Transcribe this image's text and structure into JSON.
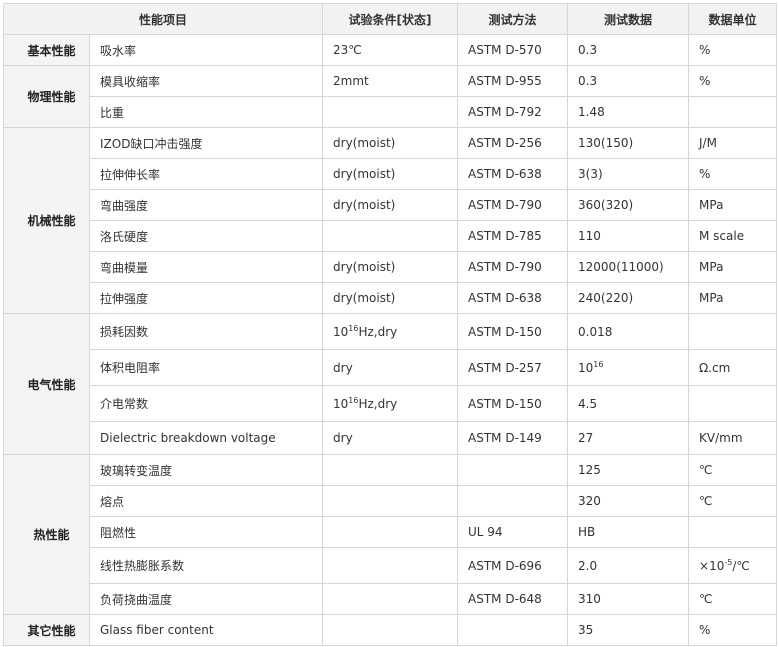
{
  "headers": [
    "性能项目",
    "试验条件[状态]",
    "测试方法",
    "测试数据",
    "数据单位"
  ],
  "groups": [
    {
      "category": "基本性能",
      "rows": [
        {
          "item": "吸水率",
          "condition": "23℃",
          "method": "ASTM D-570",
          "value": "0.3",
          "unit": "%"
        }
      ]
    },
    {
      "category": "物理性能",
      "rows": [
        {
          "item": "模具收缩率",
          "condition": "2mmt",
          "method": "ASTM D-955",
          "value": "0.3",
          "unit": "%"
        },
        {
          "item": "比重",
          "condition": "",
          "method": "ASTM D-792",
          "value": "1.48",
          "unit": ""
        }
      ]
    },
    {
      "category": "机械性能",
      "rows": [
        {
          "item": "IZOD缺口冲击强度",
          "condition": "dry(moist)",
          "method": "ASTM D-256",
          "value": "130(150)",
          "unit": "J/M"
        },
        {
          "item": "拉伸伸长率",
          "condition": "dry(moist)",
          "method": "ASTM D-638",
          "value": "3(3)",
          "unit": "%"
        },
        {
          "item": "弯曲强度",
          "condition": "dry(moist)",
          "method": "ASTM D-790",
          "value": "360(320)",
          "unit": "MPa"
        },
        {
          "item": "洛氏硬度",
          "condition": "",
          "method": "ASTM D-785",
          "value": "110",
          "unit": "M scale"
        },
        {
          "item": "弯曲模量",
          "condition": "dry(moist)",
          "method": "ASTM D-790",
          "value": "12000(11000)",
          "unit": "MPa"
        },
        {
          "item": "拉伸强度",
          "condition": "dry(moist)",
          "method": "ASTM D-638",
          "value": "240(220)",
          "unit": "MPa"
        }
      ]
    },
    {
      "category": "电气性能",
      "rows": [
        {
          "item": "损耗因数",
          "condition_base": "10",
          "condition_exp": "16",
          "condition_rest": "Hz,dry",
          "method": "ASTM D-150",
          "value": "0.018",
          "unit": ""
        },
        {
          "item": "体积电阻率",
          "condition": "dry",
          "method": "ASTM D-257",
          "value_base": "10",
          "value_exp": "16",
          "unit": "Ω.cm"
        },
        {
          "item": "介电常数",
          "condition_base": "10",
          "condition_exp": "16",
          "condition_rest": "Hz,dry",
          "method": "ASTM D-150",
          "value": "4.5",
          "unit": ""
        },
        {
          "item": "Dielectric breakdown voltage",
          "condition": "dry",
          "method": "ASTM D-149",
          "value": "27",
          "unit": "KV/mm"
        }
      ]
    },
    {
      "category": "热性能",
      "rows": [
        {
          "item": "玻璃转变温度",
          "condition": "",
          "method": "",
          "value": "125",
          "unit": "℃"
        },
        {
          "item": "熔点",
          "condition": "",
          "method": "",
          "value": "320",
          "unit": "℃"
        },
        {
          "item": "阻燃性",
          "condition": "",
          "method": "UL 94",
          "value": "HB",
          "unit": ""
        },
        {
          "item": "线性热膨胀系数",
          "condition": "",
          "method": "ASTM D-696",
          "value": "2.0",
          "unit_base": "×10",
          "unit_exp": "-5",
          "unit_rest": "/℃"
        },
        {
          "item": "负荷挠曲温度",
          "condition": "",
          "method": "ASTM D-648",
          "value": "310",
          "unit": "℃"
        }
      ]
    },
    {
      "category": "其它性能",
      "rows": [
        {
          "item": "Glass fiber content",
          "condition": "",
          "method": "",
          "value": "35",
          "unit": "%"
        }
      ]
    }
  ]
}
